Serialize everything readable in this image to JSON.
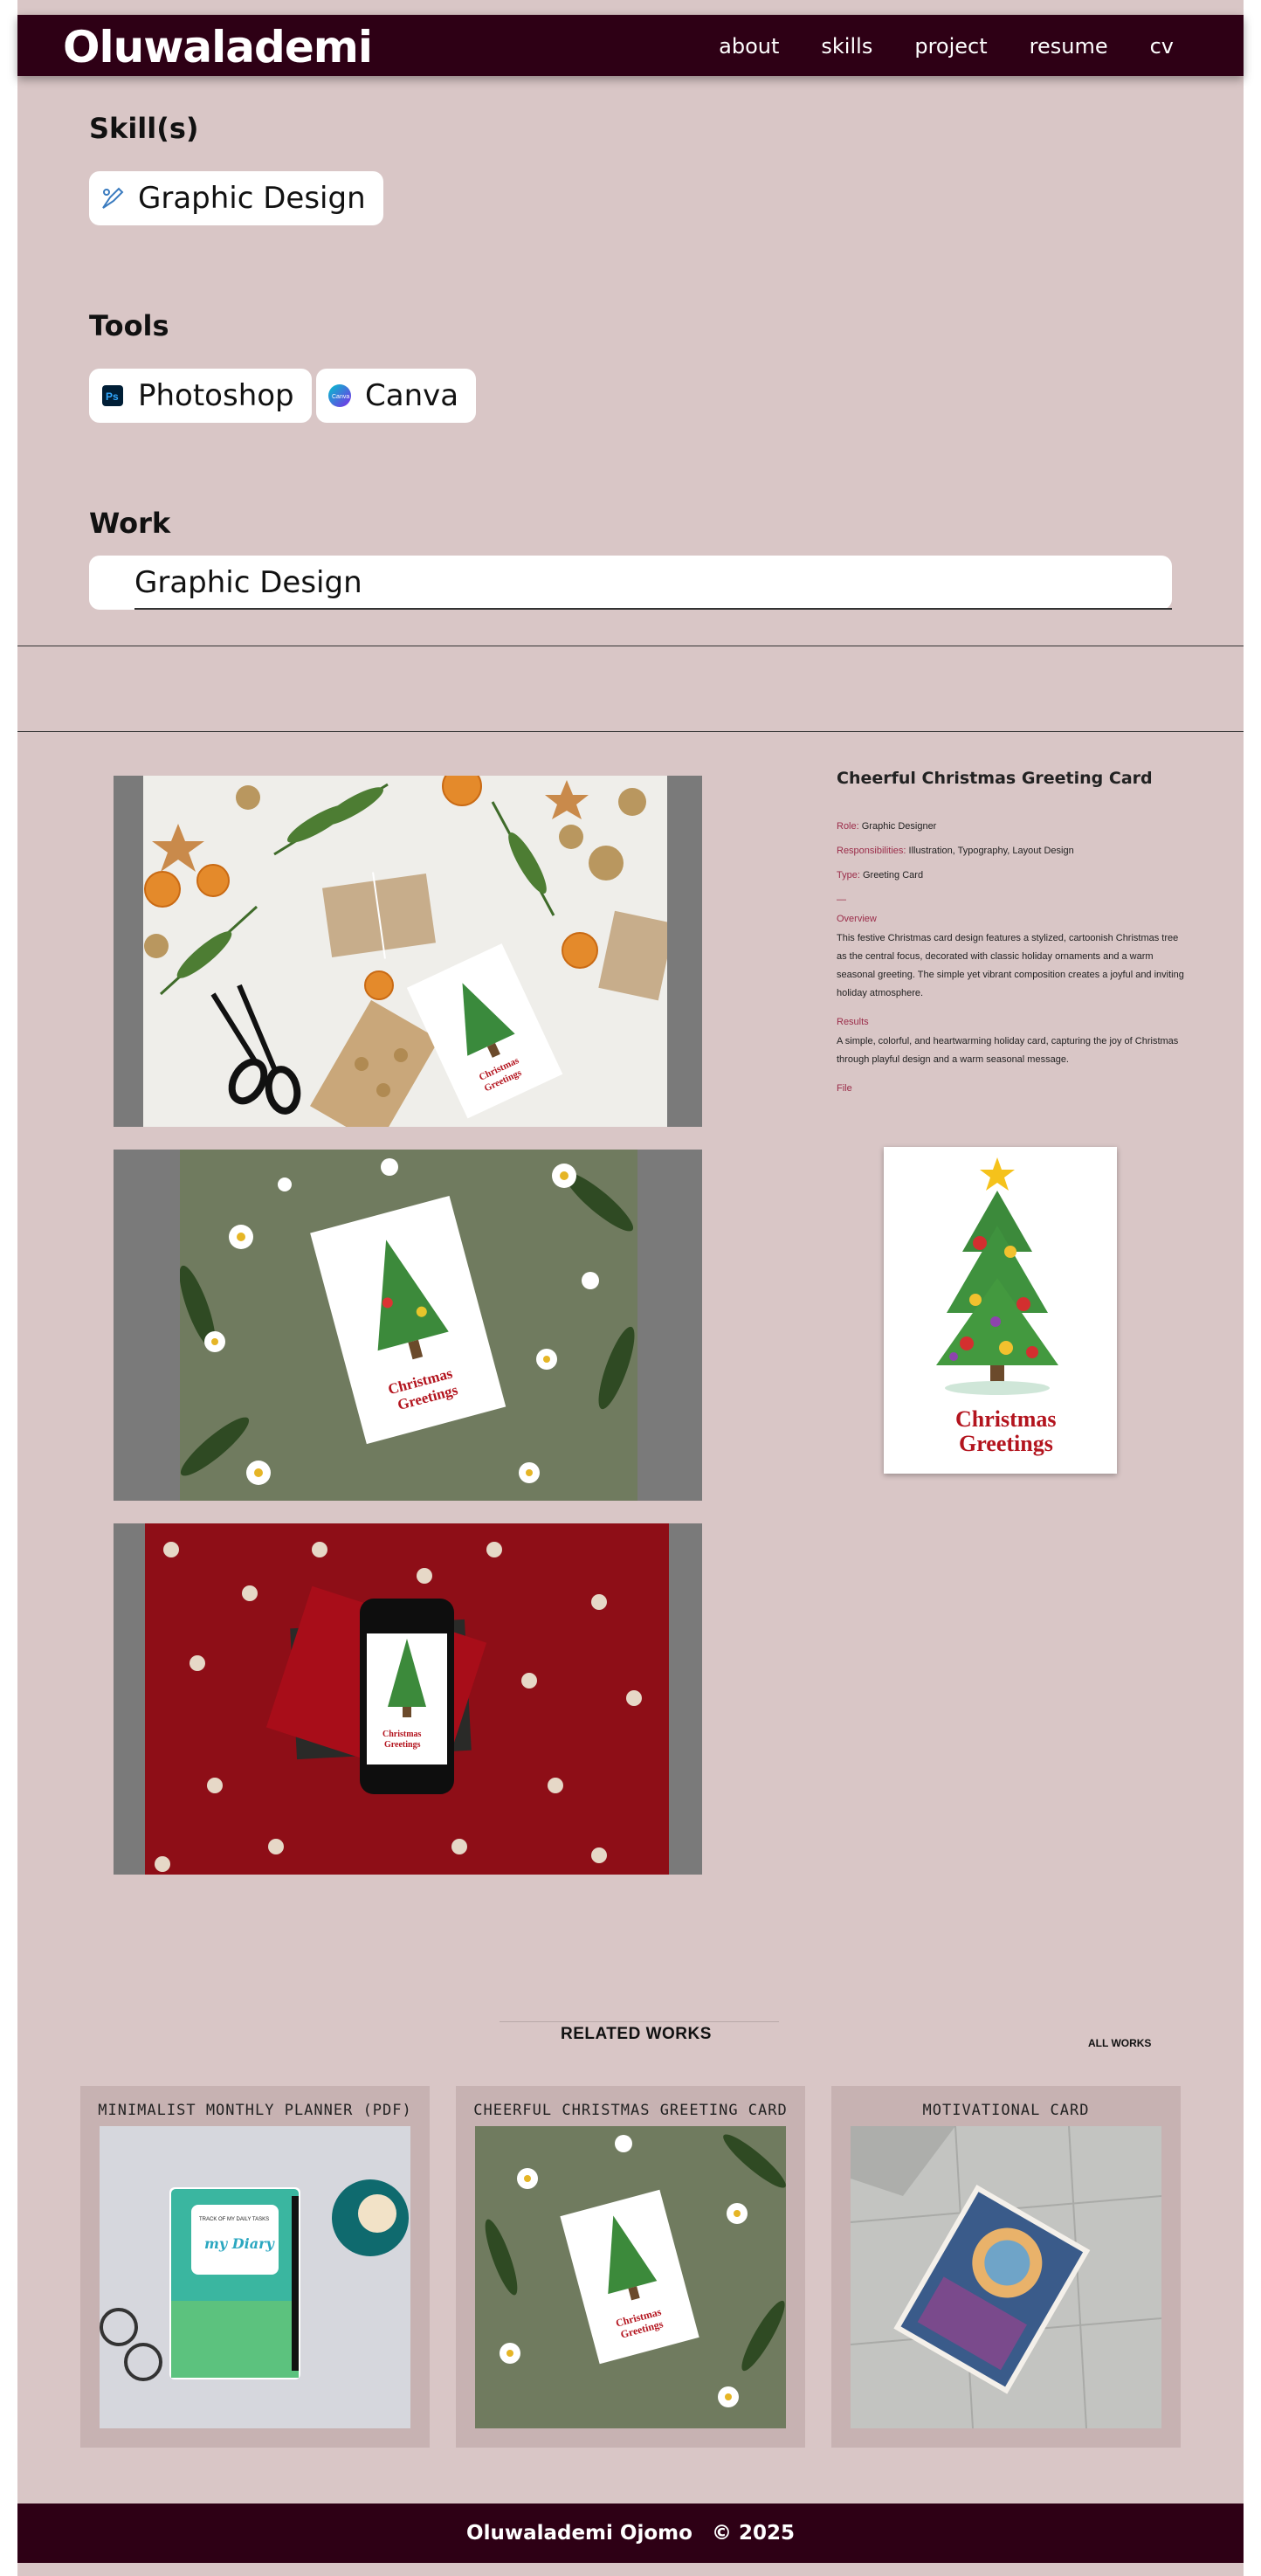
{
  "header": {
    "brand": "Oluwalademi",
    "nav": [
      "about",
      "skills",
      "project",
      "resume",
      "cv"
    ]
  },
  "skills": {
    "title": "Skill(s)",
    "items": [
      "Graphic Design"
    ]
  },
  "tools": {
    "title": "Tools",
    "items": [
      "Photoshop",
      "Canva"
    ]
  },
  "work": {
    "title": "Work",
    "selected": "Graphic Design"
  },
  "project": {
    "title": "Cheerful Christmas Greeting Card",
    "role_label": "Role:",
    "role": "Graphic Designer",
    "resp_label": "Responsibilities:",
    "resp": "Illustration, Typography, Layout Design",
    "type_label": "Type:",
    "type": "Greeting Card",
    "dash": "—",
    "overview_label": "Overview",
    "overview": "This festive Christmas card design features a stylized, cartoonish Christmas tree as the central focus, decorated with classic holiday ornaments and a warm seasonal greeting. The simple yet vibrant composition creates a joyful and inviting holiday atmosphere.",
    "results_label": "Results",
    "results": "A simple, colorful, and heartwarming holiday card, capturing the joy of Christmas through playful design and a warm seasonal message.",
    "file_label": "File",
    "card_line1": "Christmas",
    "card_line2": "Greetings"
  },
  "related": {
    "title": "RELATED WORKS",
    "all": "ALL WORKS",
    "cards": [
      {
        "title": "MINIMALIST MONTHLY PLANNER (PDF)",
        "diary_top": "TRACK OF MY DAILY TASKS",
        "diary_name": "my Diary"
      },
      {
        "title": "CHEERFUL CHRISTMAS GREETING CARD"
      },
      {
        "title": "MOTIVATIONAL CARD"
      }
    ]
  },
  "footer": {
    "name": "Oluwalademi Ojomo",
    "year": "© 2025"
  },
  "colors": {
    "page_bg": "#d9c6c6",
    "header_bg": "#2e0015",
    "accent": "#9b2d4a"
  }
}
